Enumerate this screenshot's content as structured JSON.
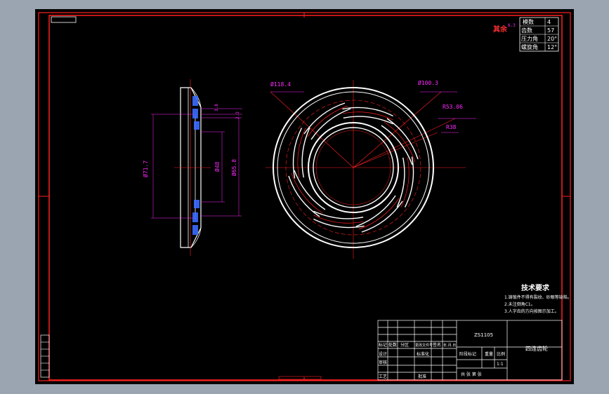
{
  "drawing": {
    "params": {
      "rows": [
        {
          "label": "模数",
          "value": "4"
        },
        {
          "label": "齿数",
          "value": "57"
        },
        {
          "label": "压力角",
          "value": "20°"
        },
        {
          "label": "螺旋角",
          "value": "12°"
        }
      ]
    },
    "surface_finish": {
      "label": "其余",
      "value": "6.3"
    },
    "dimensions": {
      "top_left": "Ø118.4",
      "top_left_tol": "0\n-0.4",
      "top_right": "Ø100.3",
      "top_right_tol": "+0.4",
      "r1": "R53.06",
      "r2": "R38",
      "side_d1": "Ø71.7",
      "side_d2": "Ø48",
      "side_d3": "Ø65.8",
      "side_t1": "2.3",
      "side_t2": "3.8"
    },
    "tech_requirements": {
      "title": "技术要求",
      "items": [
        "1.铸锻件不得有裂纹、砂眼等缺陷。",
        "2.未注倒角C1。",
        "3.人字齿的方向按图示加工。"
      ]
    },
    "title_block": {
      "drawing_no": "ZS1105",
      "part_name": "四连齿轮",
      "scale": "1:1",
      "labels": [
        "标记",
        "处数",
        "分区",
        "更改文件号",
        "签名",
        "年.月.日"
      ],
      "row2": [
        "设计",
        "标准化"
      ],
      "row3": [
        "审核"
      ],
      "row4": [
        "工艺",
        "批准"
      ],
      "stage_labels": [
        "阶段标记",
        "重量",
        "比例"
      ],
      "sheet": "共 张 第 张"
    }
  }
}
